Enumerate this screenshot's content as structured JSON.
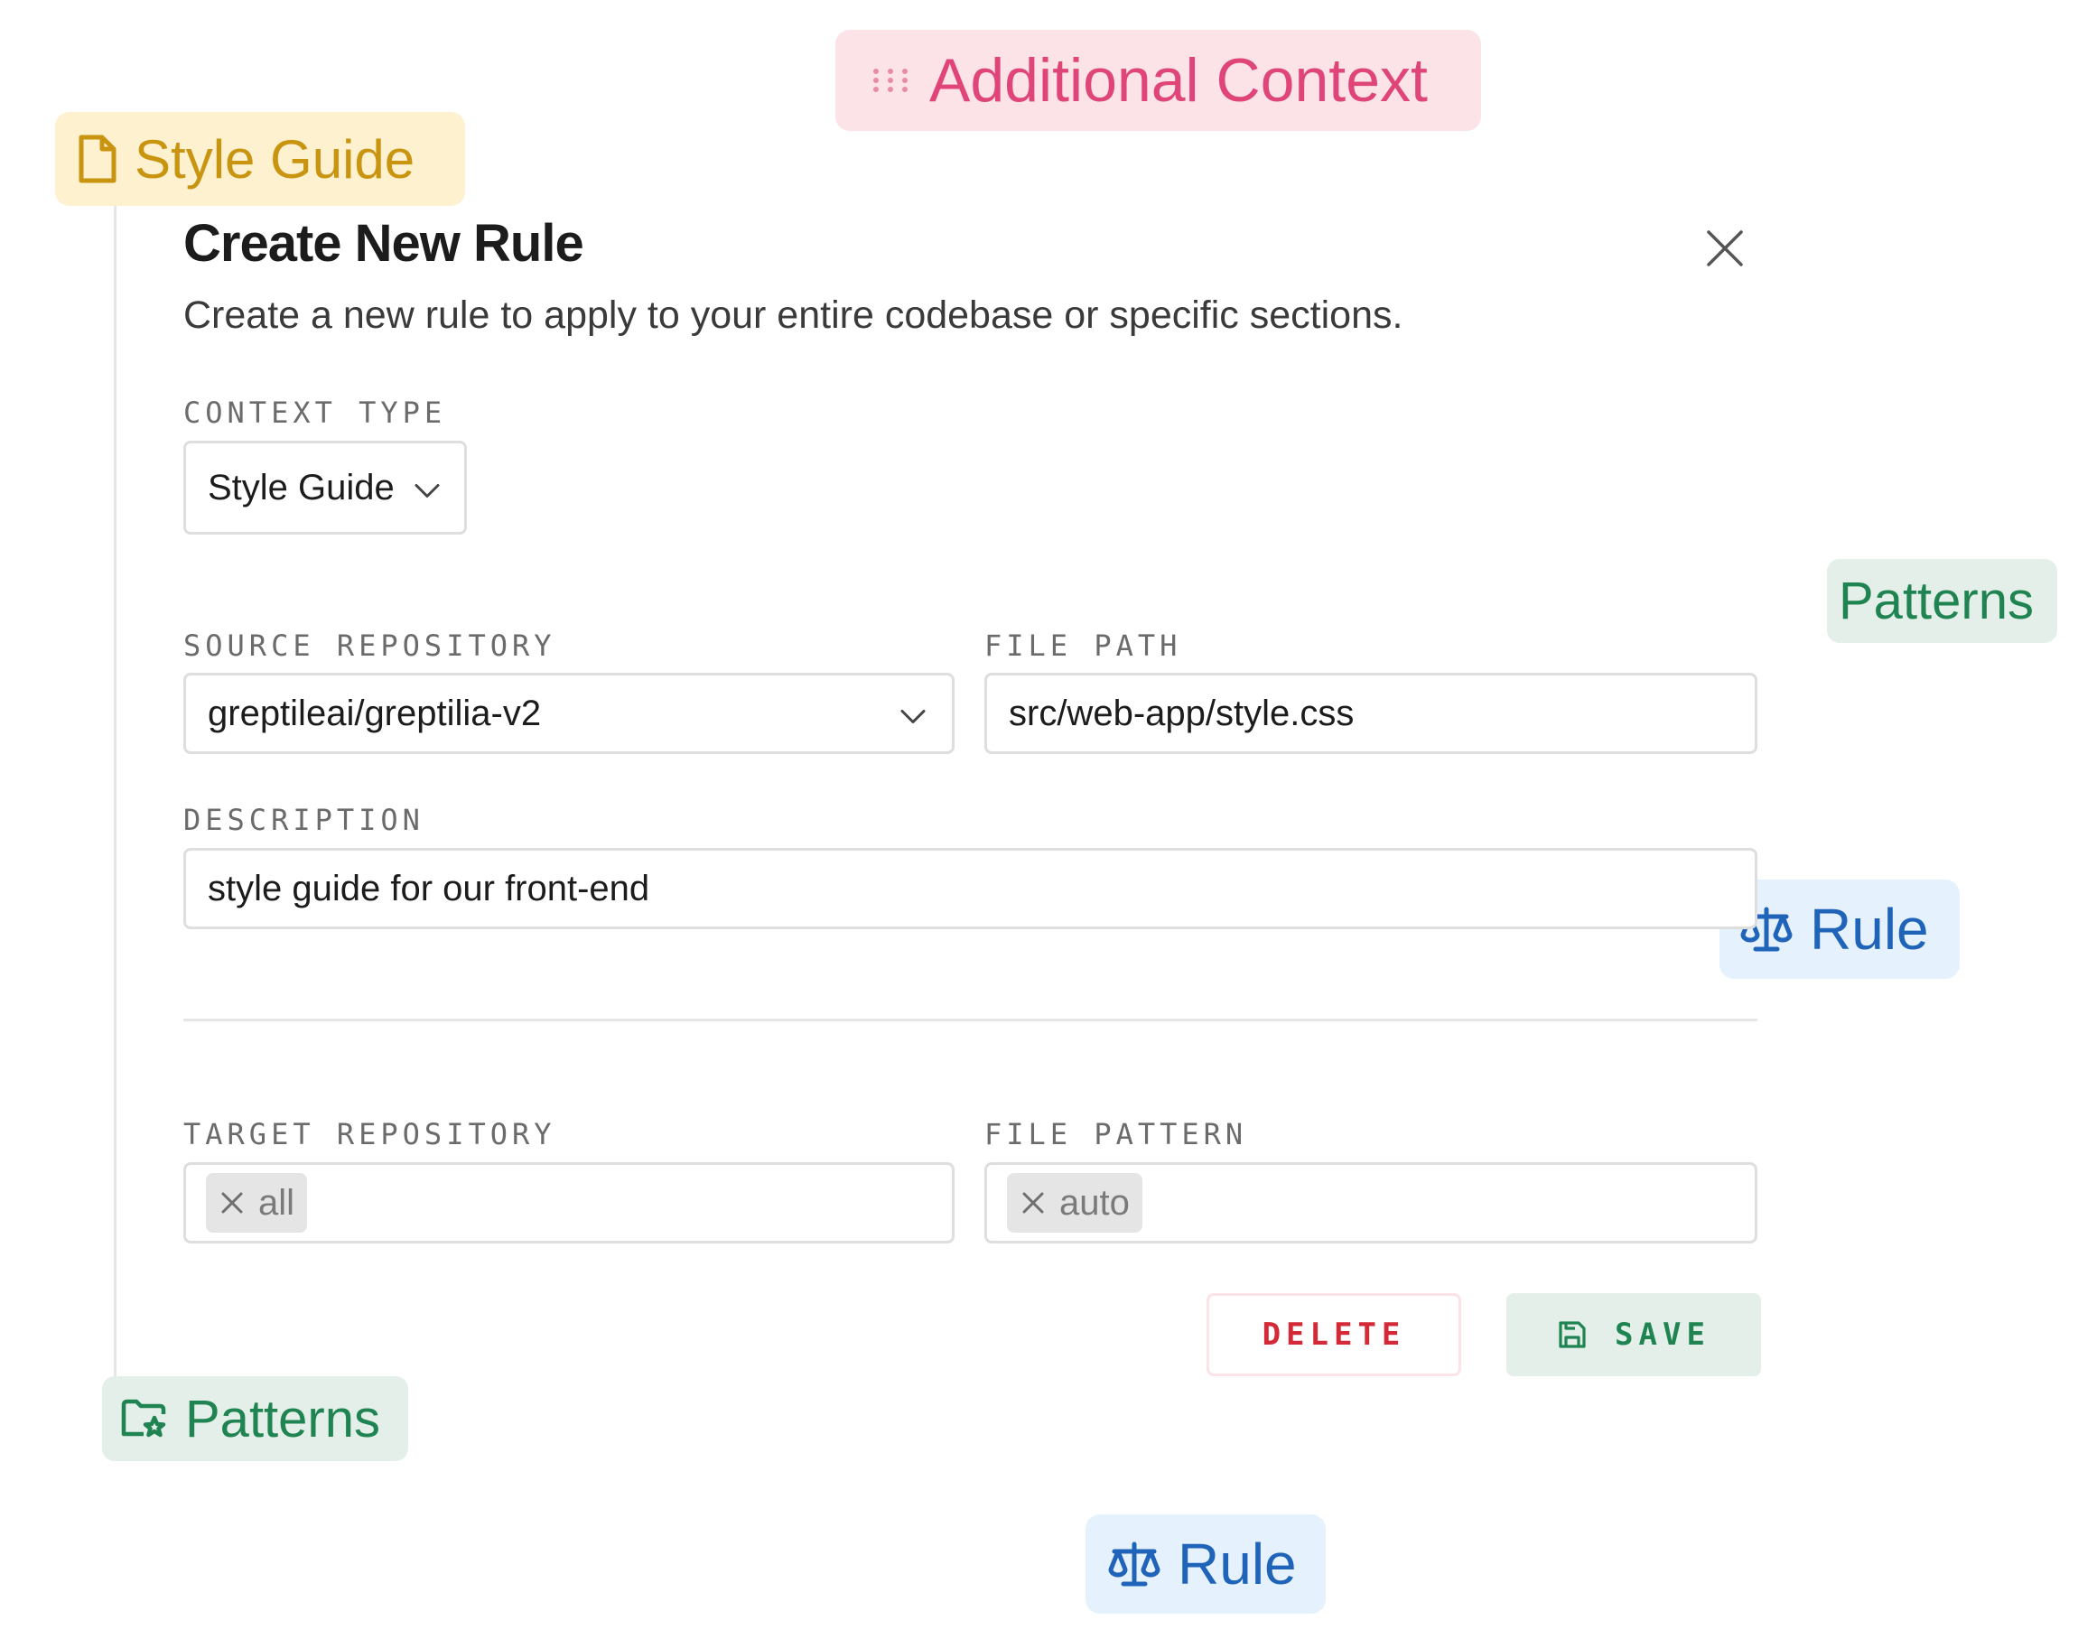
{
  "tags": {
    "additional_context": "Additional Context",
    "style_guide": "Style Guide",
    "patterns_right": "Patterns",
    "rule_right": "Rule",
    "patterns_left": "Patterns",
    "rule_bottom": "Rule"
  },
  "dialog": {
    "title": "Create New Rule",
    "subtitle": "Create a new rule to apply to your entire codebase or specific sections.",
    "context_type": {
      "label": "CONTEXT TYPE",
      "value": "Style Guide"
    },
    "source_repository": {
      "label": "SOURCE REPOSITORY",
      "value": "greptileai/greptilia-v2"
    },
    "file_path": {
      "label": "FILE PATH",
      "value": "src/web-app/style.css"
    },
    "description": {
      "label": "DESCRIPTION",
      "value": "style guide for our front-end"
    },
    "target_repository": {
      "label": "TARGET REPOSITORY",
      "chip": "all"
    },
    "file_pattern": {
      "label": "FILE PATTERN",
      "chip": "auto"
    },
    "delete_label": "DELETE",
    "save_label": "SAVE"
  },
  "colors": {
    "additional_context": "#e0457a",
    "style_guide": "#c99410",
    "patterns": "#1f8452",
    "rule": "#1f64b9",
    "delete": "#d42a38"
  },
  "icons": {
    "additional_context": "drag-handle-icon",
    "style_guide": "file-icon",
    "patterns": "folder-star-icon",
    "rule": "scale-icon",
    "close": "close-icon",
    "dropdown": "chevron-down-icon",
    "chip_remove": "x-icon",
    "save": "floppy-disk-icon"
  }
}
